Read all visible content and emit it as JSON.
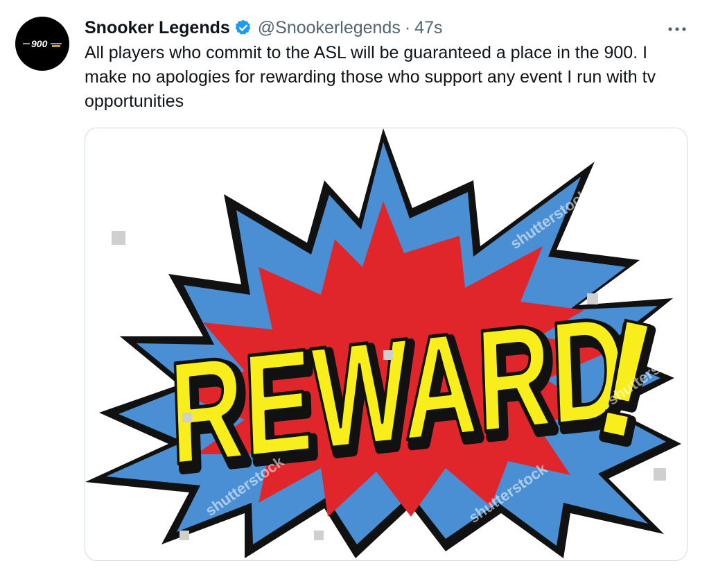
{
  "tweet": {
    "author": {
      "display_name": "Snooker Legends",
      "handle": "@Snookerlegends",
      "verified": true,
      "avatar_text": "900"
    },
    "separator": "·",
    "time": "47s",
    "text": "All players who commit to the ASL will be guaranteed a place in the 900. I make no apologies for rewarding those who support any event I run with tv opportunities",
    "media": {
      "word": "REWARD",
      "exclaim": "!",
      "watermark": "shutterstock"
    },
    "more_icon": "more-horizontal-icon"
  },
  "colors": {
    "verified": "#1d9bf0",
    "text": "#0f1419",
    "secondary": "#536471",
    "burst_blue": "#4a8fd4",
    "burst_red": "#e0262b",
    "lettering": "#f7ee1c"
  }
}
